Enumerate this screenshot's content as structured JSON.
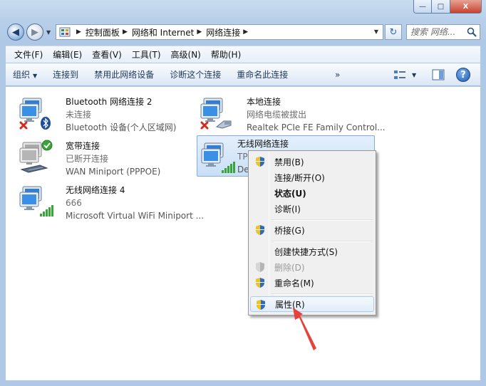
{
  "window": {
    "minimize_glyph": "—",
    "maximize_glyph": "□",
    "close_glyph": "X"
  },
  "address": {
    "crumbs": [
      "控制面板",
      "网络和 Internet",
      "网络连接"
    ]
  },
  "search": {
    "placeholder": "搜索 网络..."
  },
  "menu": [
    "文件(F)",
    "编辑(E)",
    "查看(V)",
    "工具(T)",
    "高级(N)",
    "帮助(H)"
  ],
  "toolbar": {
    "organize": "组织",
    "connect_to": "连接到",
    "disable_device": "禁用此网络设备",
    "diagnose": "诊断这个连接",
    "rename": "重命名此连接",
    "more": "»",
    "help": "?"
  },
  "connections": [
    {
      "name": "Bluetooth 网络连接 2",
      "status": "未连接",
      "device": "Bluetooth 设备(个人区域网)",
      "icon": "bluetooth-network-icon"
    },
    {
      "name": "本地连接",
      "status": "网络电缆被拔出",
      "device": "Realtek PCIe FE Family Control...",
      "icon": "ethernet-unplugged-icon"
    },
    {
      "name": "宽带连接",
      "status": "已断开连接",
      "device": "WAN Miniport (PPPOE)",
      "icon": "broadband-icon"
    },
    {
      "name": "无线网络连接",
      "status": "TP-",
      "device": "De",
      "icon": "wireless-network-icon"
    },
    {
      "name": "无线网络连接 4",
      "status": "666",
      "device": "Microsoft Virtual WiFi Miniport ...",
      "icon": "virtual-wifi-icon"
    }
  ],
  "context_menu": [
    {
      "label": "禁用(B)",
      "shield": true
    },
    {
      "label": "连接/断开(O)",
      "shield": false
    },
    {
      "label": "状态(U)",
      "shield": false,
      "bold": true
    },
    {
      "label": "诊断(I)",
      "shield": false
    },
    {
      "label": "桥接(G)",
      "shield": true
    },
    {
      "label": "创建快捷方式(S)",
      "shield": false
    },
    {
      "label": "删除(D)",
      "shield": true,
      "disabled": true
    },
    {
      "label": "重命名(M)",
      "shield": true
    },
    {
      "label": "属性(R)",
      "shield": true,
      "highlighted": true
    }
  ],
  "colors": {
    "accent": "#3b6fb6",
    "arrow": "#e8403a",
    "status_ok": "#3aa33a",
    "status_error": "#d22c1e"
  }
}
